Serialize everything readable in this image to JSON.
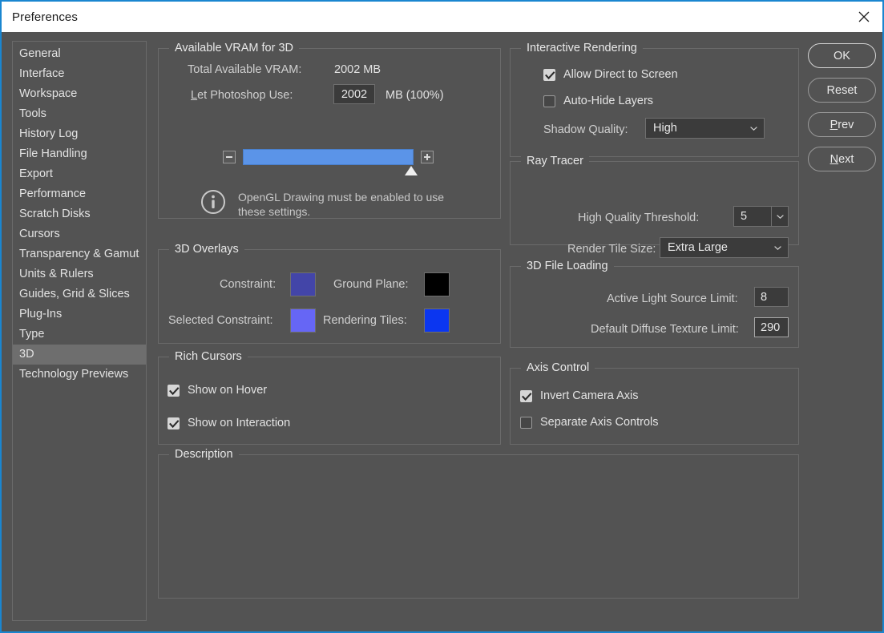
{
  "window": {
    "title": "Preferences",
    "close_icon": "close-icon",
    "border_color": "#1a86d0",
    "titlebar_bg": "#ffffff",
    "body_bg": "#535353"
  },
  "sidebar": {
    "items": [
      {
        "label": "General",
        "selected": false
      },
      {
        "label": "Interface",
        "selected": false
      },
      {
        "label": "Workspace",
        "selected": false
      },
      {
        "label": "Tools",
        "selected": false
      },
      {
        "label": "History Log",
        "selected": false
      },
      {
        "label": "File Handling",
        "selected": false
      },
      {
        "label": "Export",
        "selected": false
      },
      {
        "label": "Performance",
        "selected": false
      },
      {
        "label": "Scratch Disks",
        "selected": false
      },
      {
        "label": "Cursors",
        "selected": false
      },
      {
        "label": "Transparency & Gamut",
        "selected": false
      },
      {
        "label": "Units & Rulers",
        "selected": false
      },
      {
        "label": "Guides, Grid & Slices",
        "selected": false
      },
      {
        "label": "Plug-Ins",
        "selected": false
      },
      {
        "label": "Type",
        "selected": false
      },
      {
        "label": "3D",
        "selected": true
      },
      {
        "label": "Technology Previews",
        "selected": false
      }
    ]
  },
  "vram": {
    "legend": "Available VRAM for 3D",
    "total_label": "Total Available VRAM:",
    "total_value": "2002 MB",
    "use_label": "Let Photoshop Use:",
    "use_label_accel": "L",
    "use_label_rest": "et Photoshop Use:",
    "use_value": "2002",
    "use_suffix": "MB (100%)",
    "slider_fill_percent": 100,
    "slider_color": "#5b94e8",
    "decrement_icon": "minus-icon",
    "increment_icon": "plus-icon",
    "info_icon": "info-icon",
    "info_text": "OpenGL Drawing must be enabled to use these settings."
  },
  "overlays": {
    "legend": "3D Overlays",
    "swatches": [
      {
        "label": "Constraint:",
        "color": "#4345a8"
      },
      {
        "label": "Ground Plane:",
        "color": "#000000"
      },
      {
        "label": "Selected Constraint:",
        "color": "#6666f5"
      },
      {
        "label": "Rendering Tiles:",
        "color": "#0b36f0"
      }
    ]
  },
  "rich_cursors": {
    "legend": "Rich Cursors",
    "options": [
      {
        "label": "Show on Hover",
        "checked": true
      },
      {
        "label": "Show on Interaction",
        "checked": true
      }
    ]
  },
  "description": {
    "legend": "Description",
    "text": ""
  },
  "interactive_rendering": {
    "legend": "Interactive Rendering",
    "options": [
      {
        "label": "Allow Direct to Screen",
        "checked": true
      },
      {
        "label": "Auto-Hide Layers",
        "checked": false
      }
    ],
    "shadow_quality_label": "Shadow Quality:",
    "shadow_quality_value": "High",
    "shadow_quality_icon": "chevron-down-icon"
  },
  "ray_tracer": {
    "legend": "Ray Tracer",
    "threshold_label": "High Quality Threshold:",
    "threshold_value": "5",
    "threshold_icon": "chevron-down-icon",
    "tile_size_label": "Render Tile Size:",
    "tile_size_value": "Extra Large",
    "tile_size_icon": "chevron-down-icon"
  },
  "file_loading": {
    "legend": "3D File Loading",
    "light_limit_label": "Active Light Source Limit:",
    "light_limit_value": "8",
    "texture_limit_label": "Default Diffuse Texture Limit:",
    "texture_limit_value": "290"
  },
  "axis_control": {
    "legend": "Axis Control",
    "options": [
      {
        "label": "Invert Camera Axis",
        "checked": true
      },
      {
        "label": "Separate Axis Controls",
        "checked": false
      }
    ]
  },
  "buttons": [
    {
      "label": "OK",
      "accel": "",
      "primary": true
    },
    {
      "label": "Reset",
      "accel": "",
      "primary": false
    },
    {
      "label": "Prev",
      "accel": "P",
      "primary": false
    },
    {
      "label": "Next",
      "accel": "N",
      "primary": false
    }
  ]
}
